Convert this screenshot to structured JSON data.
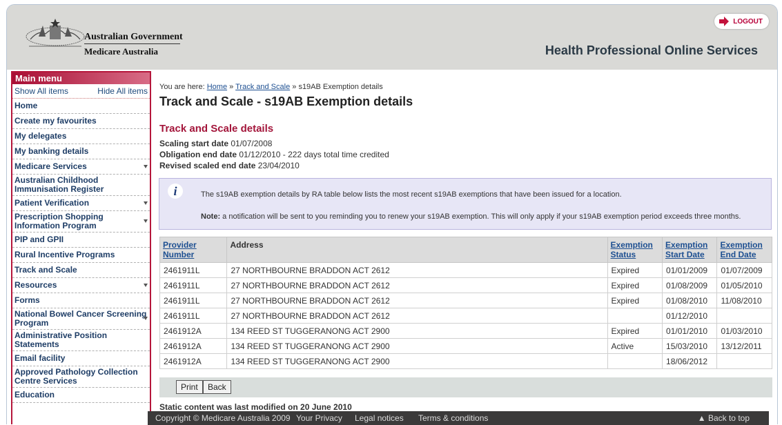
{
  "header": {
    "government": "Australian Government",
    "agency": "Medicare Australia",
    "service_title": "Health Professional Online Services",
    "logout_label": "LOGOUT"
  },
  "sidebar": {
    "title": "Main menu",
    "show_all": "Show All items",
    "hide_all": "Hide All items",
    "items": [
      {
        "label": "Home",
        "expandable": false
      },
      {
        "label": "Create my favourites",
        "expandable": false
      },
      {
        "label": "My delegates",
        "expandable": false
      },
      {
        "label": "My banking details",
        "expandable": false
      },
      {
        "label": "Medicare Services",
        "expandable": true
      },
      {
        "label": "Australian Childhood Immunisation Register",
        "expandable": false
      },
      {
        "label": "Patient Verification",
        "expandable": true
      },
      {
        "label": "Prescription Shopping Information Program",
        "expandable": true
      },
      {
        "label": "PIP and GPII",
        "expandable": false
      },
      {
        "label": "Rural Incentive Programs",
        "expandable": false
      },
      {
        "label": "Track and Scale",
        "expandable": false
      },
      {
        "label": "Resources",
        "expandable": true
      },
      {
        "label": "Forms",
        "expandable": false
      },
      {
        "label": "National Bowel Cancer Screening Program",
        "expandable": true
      },
      {
        "label": "Administrative Position Statements",
        "expandable": false
      },
      {
        "label": "Email facility",
        "expandable": false
      },
      {
        "label": "Approved Pathology Collection Centre Services",
        "expandable": false
      },
      {
        "label": "Education",
        "expandable": false
      }
    ]
  },
  "breadcrumb": {
    "prefix": "You are here:",
    "home": "Home",
    "sep": "»",
    "track": "Track and Scale",
    "current": "s19AB Exemption details"
  },
  "page_title": "Track and Scale - s19AB Exemption details",
  "details": {
    "heading": "Track and Scale details",
    "scaling_label": "Scaling start date",
    "scaling_value": "01/07/2008",
    "obligation_label": "Obligation end date",
    "obligation_value": "01/12/2010 - 222 days total time credited",
    "revised_label": "Revised scaled end date",
    "revised_value": "23/04/2010"
  },
  "info": {
    "text": "The s19AB exemption details by RA table below lists the most recent s19AB exemptions that have been issued for a location.",
    "note_label": "Note:",
    "note_text": "a notification will be sent to you reminding you to renew your s19AB exemption. This will only apply if your s19AB exemption period exceeds three months."
  },
  "table": {
    "headers": {
      "provider": "Provider Number",
      "address": "Address",
      "status": "Exemption Status",
      "start": "Exemption Start Date",
      "end": "Exemption End Date"
    },
    "rows": [
      [
        "2461911L",
        "27 NORTHBOURNE BRADDON ACT 2612",
        "Expired",
        "01/01/2009",
        "01/07/2009"
      ],
      [
        "2461911L",
        "27 NORTHBOURNE BRADDON ACT 2612",
        "Expired",
        "01/08/2009",
        "01/05/2010"
      ],
      [
        "2461911L",
        "27 NORTHBOURNE BRADDON ACT 2612",
        "Expired",
        "01/08/2010",
        "11/08/2010"
      ],
      [
        "2461911L",
        "27 NORTHBOURNE BRADDON ACT 2612",
        "",
        "01/12/2010",
        ""
      ],
      [
        "2461912A",
        "134 REED ST TUGGERANONG ACT 2900",
        "Expired",
        "01/01/2010",
        "01/03/2010"
      ],
      [
        "2461912A",
        "134 REED ST TUGGERANONG ACT 2900",
        "Active",
        "15/03/2010",
        "13/12/2011"
      ],
      [
        "2461912A",
        "134 REED ST TUGGERANONG ACT 2900",
        "",
        "18/06/2012",
        ""
      ]
    ]
  },
  "buttons": {
    "print": "Print",
    "back": "Back"
  },
  "modified": "Static content was last modified on 20 June 2010",
  "footer": {
    "copyright": "Copyright © Medicare Australia 2009",
    "privacy": "Your Privacy",
    "legal": "Legal notices",
    "terms": "Terms & conditions",
    "top": "▲ Back to top"
  }
}
